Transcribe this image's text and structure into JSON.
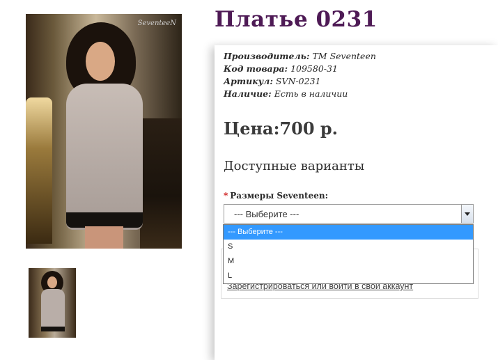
{
  "product": {
    "title": "Платье 0231",
    "image_watermark": "SeventeeN",
    "details": [
      {
        "label": "Производитель:",
        "value": "ТМ Seventeen"
      },
      {
        "label": "Код товара:",
        "value": "109580-31"
      },
      {
        "label": "Артикул:",
        "value": "SVN-0231"
      },
      {
        "label": "Наличие:",
        "value": "Есть в наличии"
      }
    ],
    "price": "Цена:700 р.",
    "options_heading": "Доступные варианты",
    "size_field": {
      "required_mark": "*",
      "label": "Размеры Seventeen:",
      "selected": "--- Выберите ---",
      "options": [
        "--- Выберите ---",
        "S",
        "M",
        "L"
      ]
    },
    "login_link": "Зарегистрироваться или войти в свой аккаунт"
  },
  "colors": {
    "title": "#4e1a55",
    "dropdown_highlight": "#3399ff",
    "required": "#cc1111"
  }
}
